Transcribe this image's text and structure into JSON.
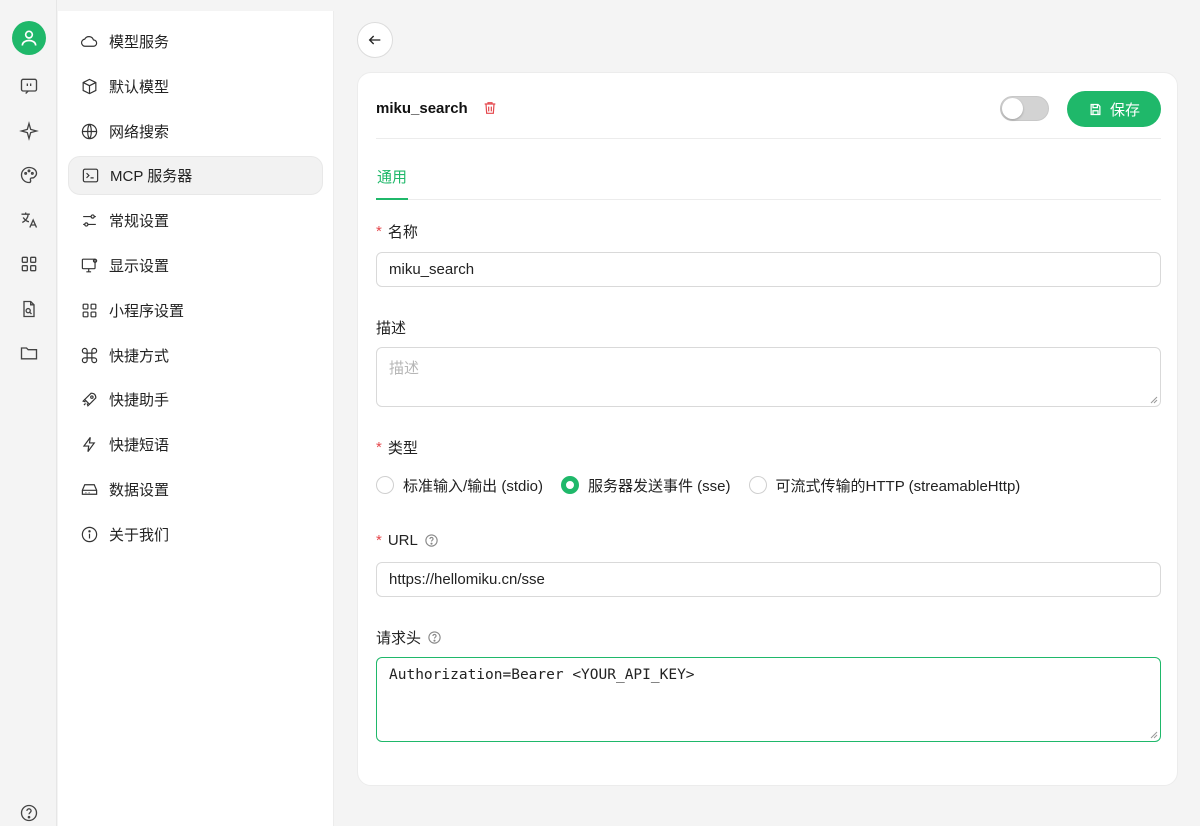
{
  "rail": {
    "icons": [
      "user-avatar-icon",
      "chat-icon",
      "sparkle-icon",
      "palette-icon",
      "translate-icon",
      "apps-icon",
      "file-search-icon",
      "folder-icon",
      "help-icon"
    ]
  },
  "menu": {
    "items": [
      {
        "label": "模型服务",
        "icon": "cloud-icon"
      },
      {
        "label": "默认模型",
        "icon": "cube-icon"
      },
      {
        "label": "网络搜索",
        "icon": "globe-icon"
      },
      {
        "label": "MCP 服务器",
        "icon": "terminal-icon",
        "active": true
      },
      {
        "label": "常规设置",
        "icon": "sliders-icon"
      },
      {
        "label": "显示设置",
        "icon": "monitor-icon"
      },
      {
        "label": "小程序设置",
        "icon": "grid-icon"
      },
      {
        "label": "快捷方式",
        "icon": "command-icon"
      },
      {
        "label": "快捷助手",
        "icon": "rocket-icon"
      },
      {
        "label": "快捷短语",
        "icon": "bolt-icon"
      },
      {
        "label": "数据设置",
        "icon": "drive-icon"
      },
      {
        "label": "关于我们",
        "icon": "info-icon"
      }
    ]
  },
  "header": {
    "server_name": "miku_search",
    "save_label": "保存",
    "enabled": false
  },
  "tabs": [
    {
      "label": "通用",
      "active": true
    }
  ],
  "form": {
    "name_label": "名称",
    "name_value": "miku_search",
    "desc_label": "描述",
    "desc_placeholder": "描述",
    "type_label": "类型",
    "type_options": [
      {
        "label": "标准输入/输出 (stdio)",
        "selected": false
      },
      {
        "label": "服务器发送事件 (sse)",
        "selected": true
      },
      {
        "label": "可流式传输的HTTP (streamableHttp)",
        "selected": false
      }
    ],
    "url_label": "URL",
    "url_value": "https://hellomiku.cn/sse",
    "headers_label": "请求头",
    "headers_value": "Authorization=Bearer <YOUR_API_KEY>"
  },
  "colors": {
    "accent": "#1fb86a",
    "danger": "#e5484d"
  }
}
